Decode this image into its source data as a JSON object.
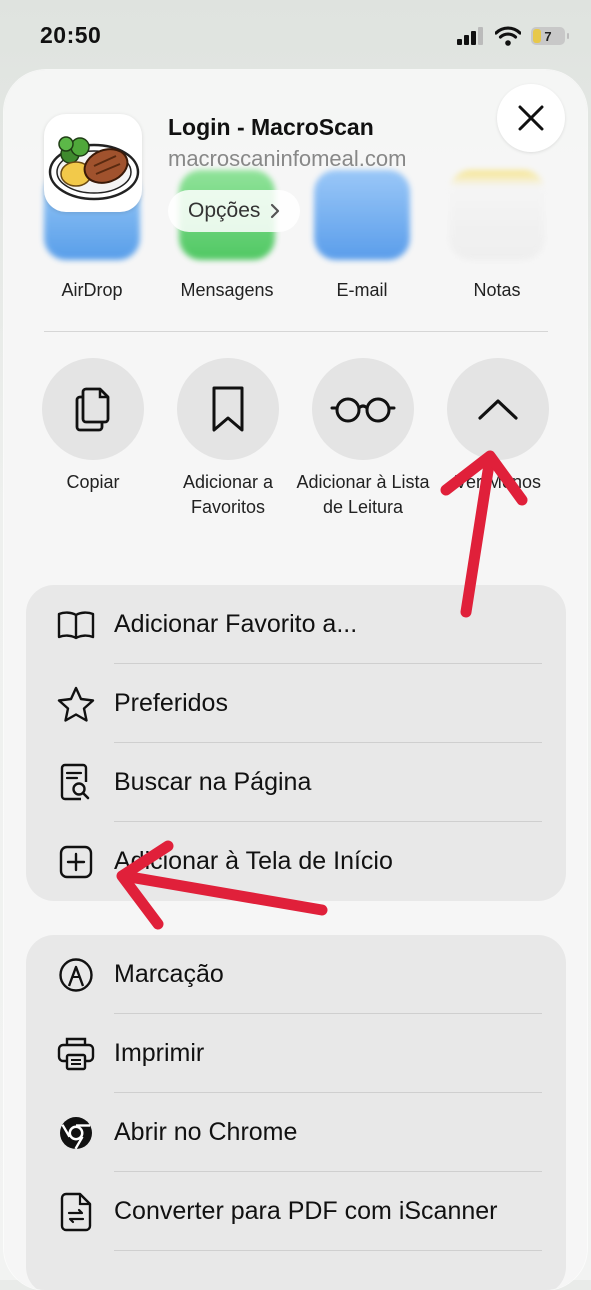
{
  "status": {
    "time": "20:50",
    "battery": "7"
  },
  "header": {
    "title": "Login - MacroScan",
    "url": "macroscaninfomeal.com",
    "options_label": "Opções",
    "app_icon": "steak-plate-icon"
  },
  "share_apps": [
    {
      "label": "AirDrop",
      "color": "#5aa6f0",
      "icon": "airdrop-icon"
    },
    {
      "label": "Mensagens",
      "color": "#5fd36c",
      "icon": "messages-icon"
    },
    {
      "label": "E-mail",
      "color": "#6aa9f4",
      "icon": "mail-icon"
    },
    {
      "label": "Notas",
      "color": "#f2f2f2",
      "icon": "notes-icon"
    }
  ],
  "actions": [
    {
      "label": "Copiar",
      "icon": "copy-icon"
    },
    {
      "label": "Adicionar a Favoritos",
      "icon": "bookmark-icon"
    },
    {
      "label": "Adicionar à Lista de Leitura",
      "icon": "glasses-icon"
    },
    {
      "label": "Ver Menos",
      "icon": "chevron-up-icon"
    }
  ],
  "menu_group_1": [
    {
      "label": "Adicionar Favorito a...",
      "icon": "book-icon"
    },
    {
      "label": "Preferidos",
      "icon": "star-icon"
    },
    {
      "label": "Buscar na Página",
      "icon": "find-in-page-icon"
    },
    {
      "label": "Adicionar à Tela de Início",
      "icon": "add-square-icon"
    }
  ],
  "menu_group_2": [
    {
      "label": "Marcação",
      "icon": "markup-icon"
    },
    {
      "label": "Imprimir",
      "icon": "printer-icon"
    },
    {
      "label": "Abrir no Chrome",
      "icon": "chrome-icon"
    },
    {
      "label": "Converter para PDF com iScanner",
      "icon": "pdf-convert-icon"
    }
  ],
  "colors": {
    "annotation_arrow": "#e0203a",
    "sheet_bg": "#f6f6f6",
    "group_bg": "#e8e8e8"
  }
}
